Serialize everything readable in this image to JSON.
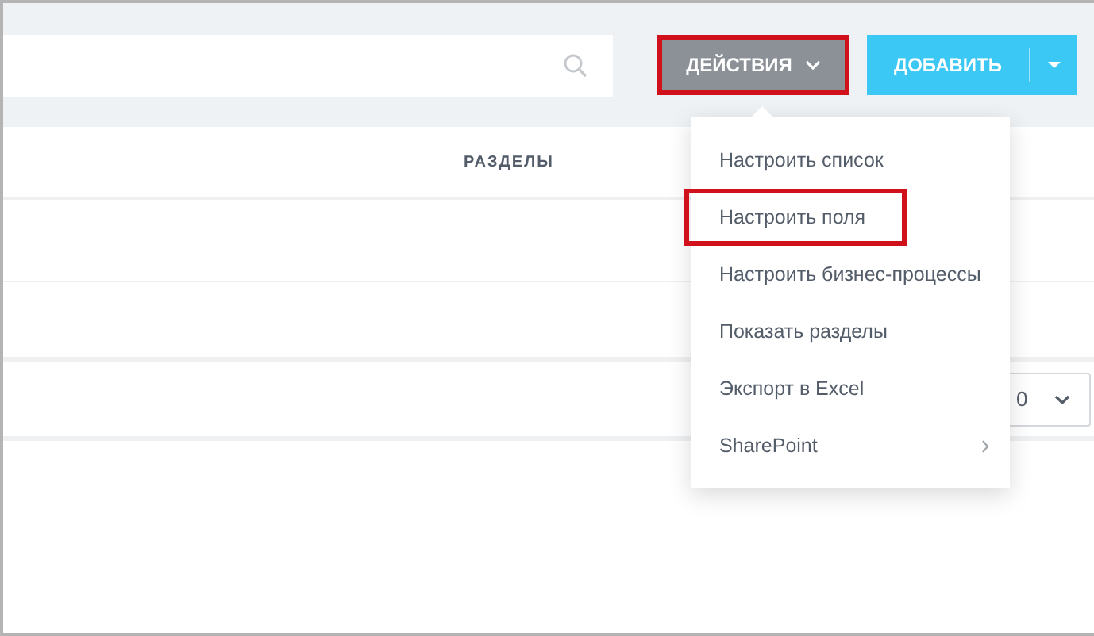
{
  "toolbar": {
    "actions_button": {
      "label": "ДЕЙСТВИЯ",
      "highlighted": true,
      "expanded": true
    },
    "add_button": {
      "label": "ДОБАВИТЬ"
    }
  },
  "table": {
    "columns": [
      {
        "label": "РАЗДЕЛЫ"
      }
    ]
  },
  "pagination": {
    "page_size": "0"
  },
  "menu": {
    "items": [
      {
        "label": "Настроить список",
        "highlighted": false,
        "submenu": false
      },
      {
        "label": "Настроить поля",
        "highlighted": true,
        "submenu": false
      },
      {
        "label": "Настроить бизнес-процессы",
        "highlighted": false,
        "submenu": false
      },
      {
        "label": "Показать разделы",
        "highlighted": false,
        "submenu": false
      },
      {
        "label": "Экспорт в Excel",
        "highlighted": false,
        "submenu": false
      },
      {
        "label": "SharePoint",
        "highlighted": false,
        "submenu": true
      }
    ]
  }
}
